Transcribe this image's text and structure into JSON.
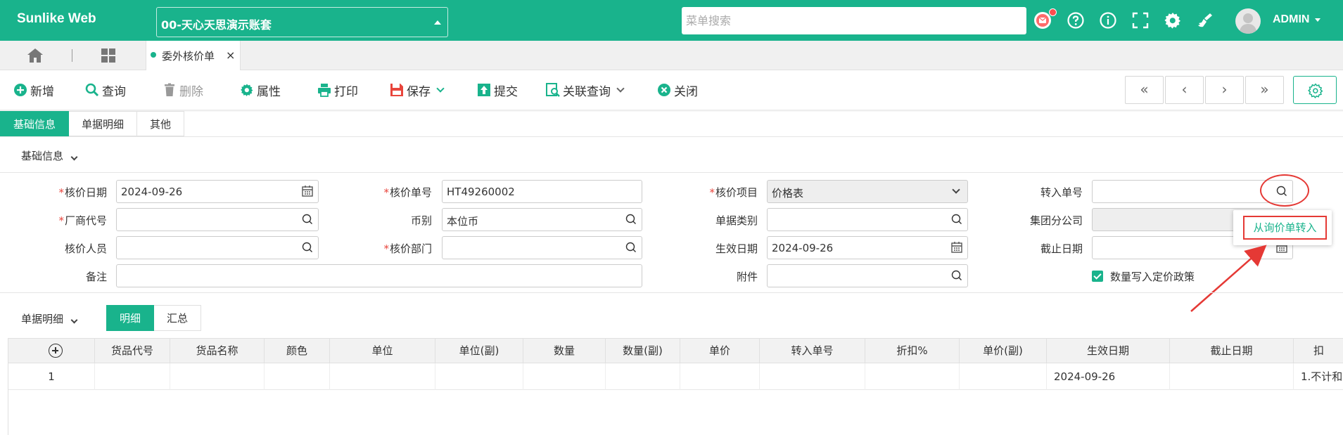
{
  "header": {
    "brand": "Sunlike Web",
    "company": "00-天心天思演示账套",
    "menu_search_placeholder": "菜单搜索",
    "user": "ADMIN"
  },
  "tabs": {
    "active_label": "委外核价单",
    "close_glyph": "×"
  },
  "toolbar": {
    "new": "新增",
    "query": "查询",
    "delete": "删除",
    "properties": "属性",
    "print": "打印",
    "save": "保存",
    "submit": "提交",
    "related_query": "关联查询",
    "close": "关闭",
    "nav": [
      "«",
      "‹",
      "›",
      "»"
    ]
  },
  "section_tabs": [
    "基础信息",
    "单据明细",
    "其他"
  ],
  "basic_section_title": "基础信息",
  "form": {
    "price_date": {
      "label": "核价日期",
      "value": "2024-09-26"
    },
    "price_no": {
      "label": "核价单号",
      "value": "HT49260002"
    },
    "price_item": {
      "label": "核价项目",
      "value": "价格表"
    },
    "transfer_no": {
      "label": "转入单号",
      "value": ""
    },
    "vendor_code": {
      "label": "厂商代号",
      "value": ""
    },
    "currency": {
      "label": "币别",
      "value": "本位币"
    },
    "doc_type": {
      "label": "单据类别",
      "value": ""
    },
    "group_branch": {
      "label": "集团分公司",
      "value": ""
    },
    "price_person": {
      "label": "核价人员",
      "value": ""
    },
    "price_dept": {
      "label": "核价部门",
      "value": ""
    },
    "effective_date": {
      "label": "生效日期",
      "value": "2024-09-26"
    },
    "end_date": {
      "label": "截止日期",
      "value": ""
    },
    "remark": {
      "label": "备注",
      "value": ""
    },
    "attachment": {
      "label": "附件",
      "value": ""
    },
    "write_qty_checkbox": {
      "label": "数量写入定价政策",
      "checked": true
    },
    "required_mark": "*"
  },
  "popup": {
    "item": "从询价单转入"
  },
  "detail": {
    "title": "单据明细",
    "tabs": [
      "明细",
      "汇总"
    ],
    "columns": [
      "货品代号",
      "货品名称",
      "颜色",
      "单位",
      "单位(副)",
      "数量",
      "数量(副)",
      "单价",
      "转入单号",
      "折扣%",
      "单价(副)",
      "生效日期",
      "截止日期",
      "扣"
    ],
    "rows": [
      {
        "no": "1",
        "effective_date": "2024-09-26",
        "last": "1.不计和"
      }
    ]
  },
  "colors": {
    "accent": "#19b38c",
    "annotation": "#e53935"
  }
}
